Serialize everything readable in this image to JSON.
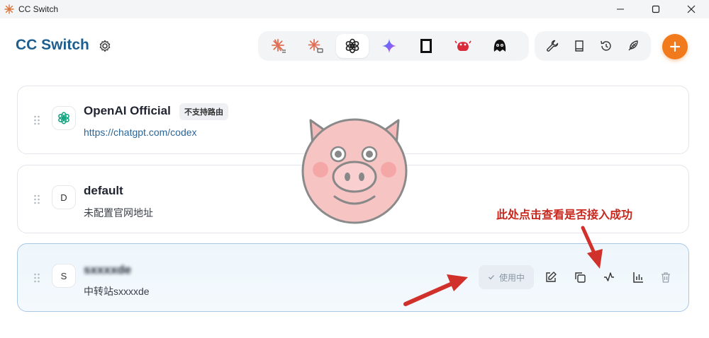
{
  "window": {
    "title": "CC Switch"
  },
  "header": {
    "brand": "CC Switch",
    "providers": [
      {
        "name": "claude-icon",
        "active": false
      },
      {
        "name": "claude-desktop-icon",
        "active": false
      },
      {
        "name": "openai-icon",
        "active": true
      },
      {
        "name": "gemini-icon",
        "active": false
      },
      {
        "name": "terminal-icon",
        "active": false
      },
      {
        "name": "crab-icon",
        "active": false
      },
      {
        "name": "mascot-icon",
        "active": false
      }
    ],
    "tools": [
      "wrench-icon",
      "book-icon",
      "history-icon",
      "feather-icon"
    ]
  },
  "providers": [
    {
      "avatar": "",
      "name": "OpenAI Official",
      "badge": "不支持路由",
      "subtitle": "https://chatgpt.com/codex",
      "active": false
    },
    {
      "avatar": "D",
      "name": "default",
      "subtitle": "未配置官网地址",
      "active": false
    },
    {
      "avatar": "S",
      "name": "sxxxxde",
      "subtitle": "中转站sxxxxde",
      "active": true,
      "status": "使用中"
    }
  ],
  "annotation": "此处点击查看是否接入成功",
  "colors": {
    "accent": "#f07a1c",
    "brand": "#1d5e8f",
    "annotation": "#c8281e"
  }
}
